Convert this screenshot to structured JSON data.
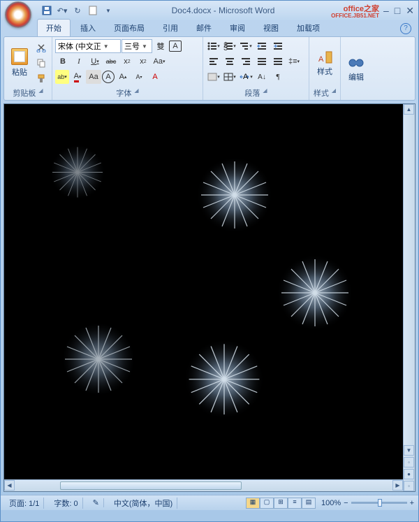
{
  "title": "Doc4.docx - Microsoft Word",
  "watermark": {
    "main": "office之家",
    "sub": "OFFICE.JB51.NET"
  },
  "tabs": [
    "开始",
    "插入",
    "页面布局",
    "引用",
    "邮件",
    "审阅",
    "视图",
    "加载项"
  ],
  "active_tab": 0,
  "ribbon": {
    "clipboard": {
      "label": "剪贴板",
      "paste": "粘贴"
    },
    "font": {
      "label": "字体",
      "family": "宋体 (中文正",
      "size": "三号"
    },
    "paragraph": {
      "label": "段落"
    },
    "styles": {
      "label": "样式"
    },
    "editing": {
      "label": "编辑"
    }
  },
  "status": {
    "page": "页面: 1/1",
    "words": "字数: 0",
    "lang": "中文(简体，中国)",
    "zoom": "100%"
  },
  "icons": {
    "save": "💾",
    "undo": "↶",
    "redo": "↻",
    "new": "▢",
    "bold": "B",
    "italic": "I",
    "underline": "U",
    "strike": "abc",
    "sub": "x₂",
    "sup": "x²",
    "highlight": "ab",
    "fontcolor": "A",
    "grow": "A",
    "shrink": "A",
    "clear": "Aa",
    "changecase": "Aa",
    "pinyin": "拼",
    "border": "A",
    "charborder": "A",
    "charshade": "字",
    "bullets": "≡",
    "numbers": "≡",
    "multilevel": "≡",
    "dedent": "≤",
    "indent": "≥",
    "left": "≡",
    "center": "≡",
    "right": "≡",
    "justify": "≡",
    "dist": "≡",
    "linespace": "↕",
    "shading": "▢",
    "borders": "⊞",
    "sort": "↓",
    "marks": "¶"
  }
}
